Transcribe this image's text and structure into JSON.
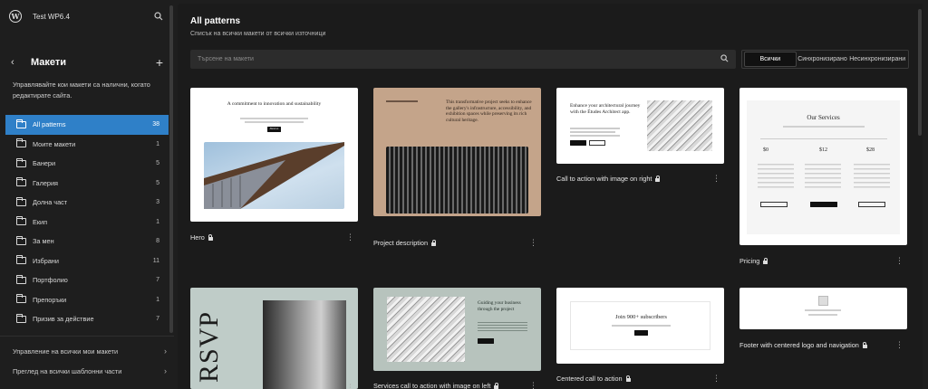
{
  "sidebar": {
    "site_name": "Test WP6.4",
    "title": "Макети",
    "description": "Управлявайте кои макети са налични, когато редактирате сайта.",
    "categories": [
      {
        "label": "All patterns",
        "count": "38"
      },
      {
        "label": "Моите макети",
        "count": "1"
      },
      {
        "label": "Банери",
        "count": "5"
      },
      {
        "label": "Галерия",
        "count": "5"
      },
      {
        "label": "Долна част",
        "count": "3"
      },
      {
        "label": "Екип",
        "count": "1"
      },
      {
        "label": "За мен",
        "count": "8"
      },
      {
        "label": "Избрани",
        "count": "11"
      },
      {
        "label": "Портфолио",
        "count": "7"
      },
      {
        "label": "Препоръки",
        "count": "1"
      },
      {
        "label": "Призив за действие",
        "count": "7"
      }
    ],
    "manage_link": "Управление на всички мои макети",
    "template_parts_link": "Преглед на всички шаблонни части"
  },
  "main": {
    "title": "All patterns",
    "subtitle": "Списък на всички макети от всички източници",
    "search_placeholder": "Търсене на макети",
    "filters": [
      "Всички",
      "Синхронизирано",
      "Несинхронизирани"
    ]
  },
  "patterns": [
    {
      "title": "Hero"
    },
    {
      "title": "Project description"
    },
    {
      "title": "Call to action with image on right"
    },
    {
      "title": "Pricing"
    },
    {
      "title": "Services call to action with image on left"
    },
    {
      "title": "Centered call to action"
    },
    {
      "title": "Footer with centered logo and navigation"
    }
  ],
  "thumbs": {
    "hero_heading": "A commitment to innovation and sustainability",
    "hero_btn": "About us",
    "project_heading": "This transformative project seeks to enhance the gallery's infrastructure, accessibility, and exhibition spaces while preserving its rich cultural heritage.",
    "cta_right_heading": "Enhance your architectural journey with the Études Architect app.",
    "pricing_heading": "Our Services",
    "pricing_prices": [
      "$0",
      "$12",
      "$28"
    ],
    "rsvp": "RSVP",
    "services_heading": "Guiding your business through the project",
    "centered_heading": "Join 900+ subscribers"
  },
  "colors": {
    "accent": "#2f80c8",
    "project_bg": "#c4a48a",
    "services_bg": "#b7c3bd",
    "rsvp_bg": "#bfccc8"
  }
}
